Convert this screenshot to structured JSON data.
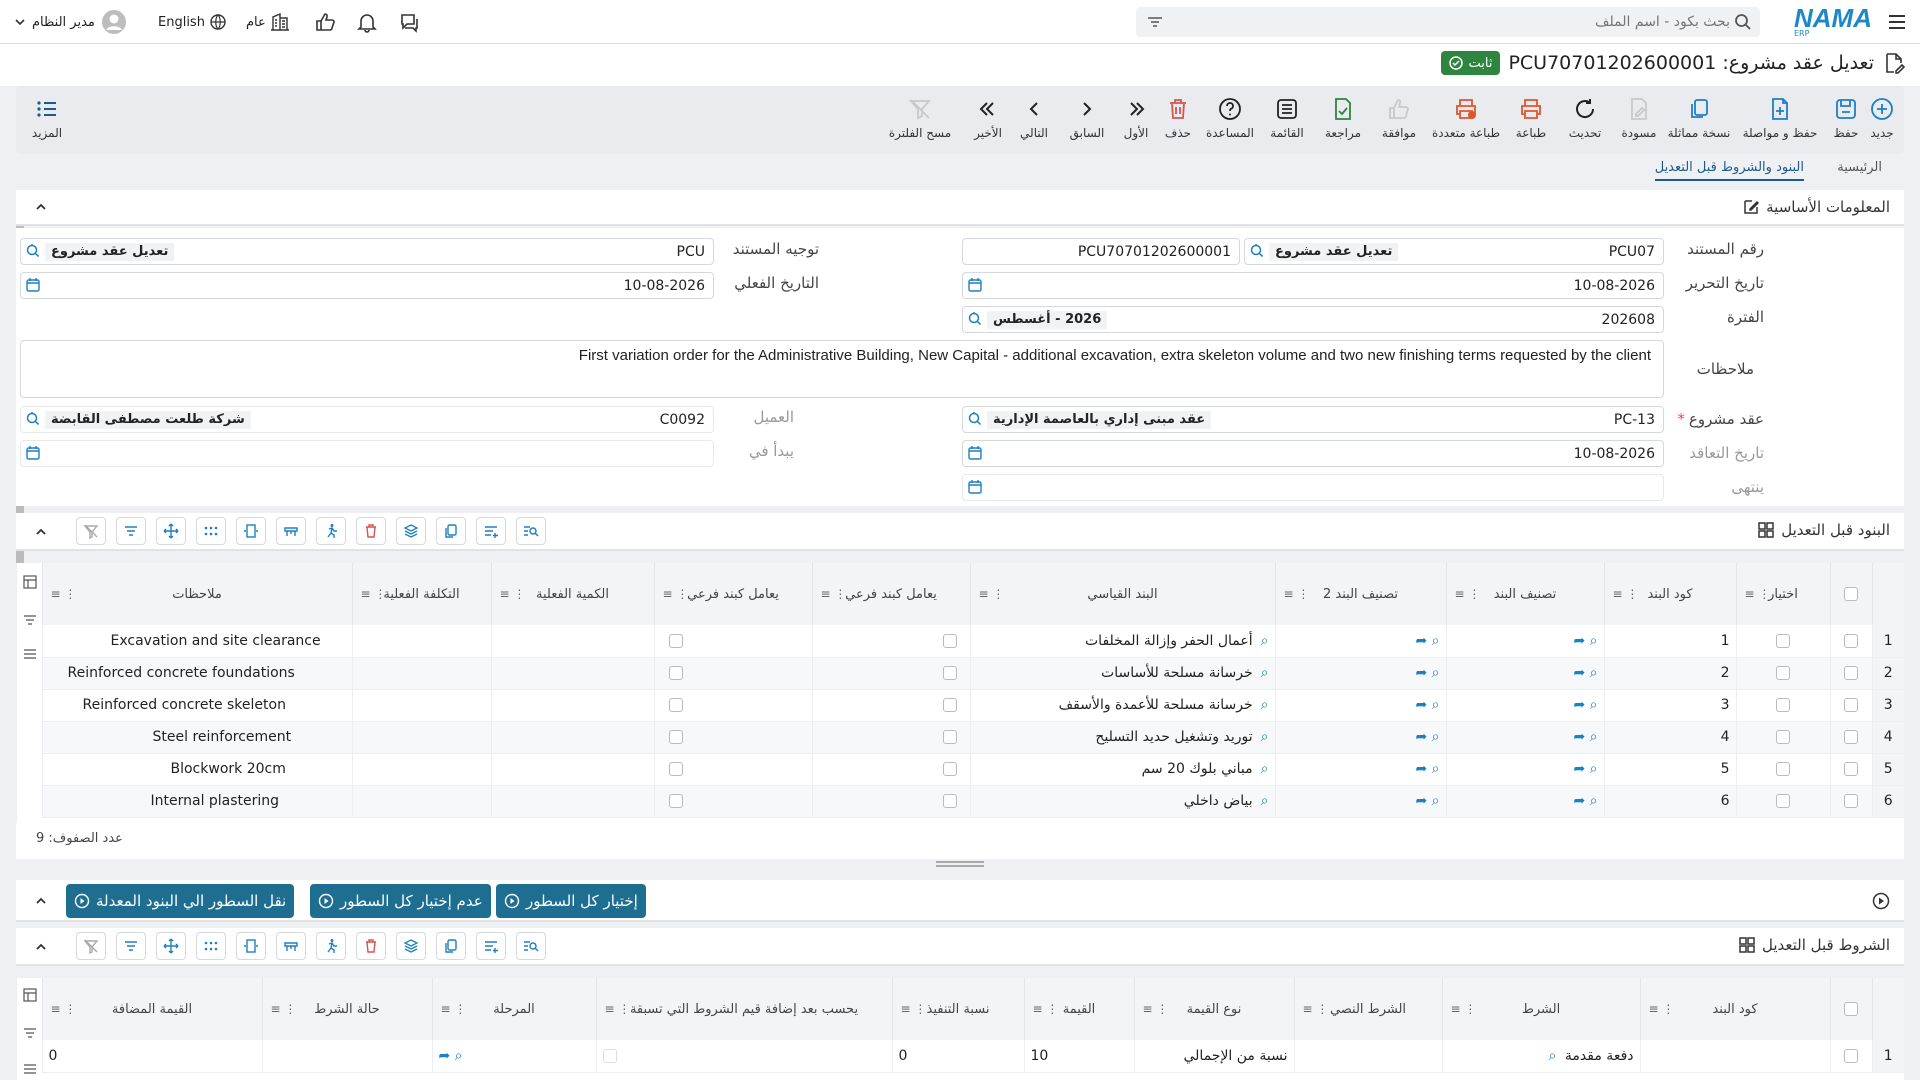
{
  "topbar": {
    "logo": "NAMA",
    "logo_sub": "ERP",
    "search_placeholder": "بحث بكود - اسم الملف",
    "user_name": "مدير النظام",
    "language": "English",
    "scope": "عام"
  },
  "title": {
    "text": "تعديل عقد مشروع: PCU70701202600001",
    "status": "ثابت"
  },
  "toolbar": {
    "items": [
      {
        "label": "جديد",
        "icon": "plus-circle-icon"
      },
      {
        "label": "حفظ",
        "icon": "save-icon"
      },
      {
        "label": "حفظ و مواصلة",
        "icon": "file-plus-icon"
      },
      {
        "label": "نسخة مماثلة",
        "icon": "copy-icon"
      },
      {
        "label": "مسودة",
        "icon": "draft-icon"
      },
      {
        "label": "تحديث",
        "icon": "refresh-icon"
      },
      {
        "label": "طباعة",
        "icon": "print-icon"
      },
      {
        "label": "طباعة متعددة",
        "icon": "multi-print-icon"
      },
      {
        "label": "موافقة",
        "icon": "thumbs-up-icon"
      },
      {
        "label": "مراجعة",
        "icon": "review-icon"
      },
      {
        "label": "القائمة",
        "icon": "list-icon"
      },
      {
        "label": "المساعدة",
        "icon": "help-icon"
      },
      {
        "label": "حذف",
        "icon": "delete-icon"
      },
      {
        "label": "الأول",
        "icon": "first-icon"
      },
      {
        "label": "السابق",
        "icon": "prev-icon"
      },
      {
        "label": "التالي",
        "icon": "next-icon"
      },
      {
        "label": "الأخير",
        "icon": "last-icon"
      },
      {
        "label": "مسح الفلترة",
        "icon": "clear-filter-icon"
      }
    ],
    "more": "المزيد"
  },
  "tabs": [
    "الرئيسية",
    "البنود والشروط قبل التعديل"
  ],
  "basic": {
    "title": "المعلومات الأساسية",
    "doc_number_label": "رقم المستند",
    "doc_number_code": "PCU07",
    "doc_number_name": "تعديل عقد مشروع",
    "doc_number_value": "PCU70701202600001",
    "direction_label": "توجيه المستند",
    "direction_code": "PCU",
    "direction_name": "تعديل عقد مشروع",
    "edit_date_label": "تاريخ التحرير",
    "edit_date": "10-08-2026",
    "actual_date_label": "التاريخ الفعلي",
    "actual_date": "10-08-2026",
    "period_label": "الفترة",
    "period_code": "202608",
    "period_name": "2026 - أغسطس",
    "notes_label": "ملاحظات",
    "notes": "First variation order for the Administrative Building, New Capital - additional excavation, extra skeleton volume and two new finishing terms requested by the client",
    "contract_label": "عقد مشروع",
    "contract_code": "PC-13",
    "contract_name": "عقد مبنى إداري بالعاصمة الإدارية",
    "client_label": "العميل",
    "client_code": "C0092",
    "client_name": "شركة طلعت مصطفى القابضة",
    "contract_date_label": "تاريخ التعاقد",
    "contract_date": "10-08-2026",
    "start_label": "يبدأ في",
    "end_label": "ينتهى"
  },
  "items_section": {
    "title": "البنود قبل التعديل",
    "columns": [
      "اختيار",
      "كود البند",
      "تصنيف البند",
      "تصنيف البند 2",
      "البند القياسي",
      "يعامل كبند فرعي",
      "يعامل كبند فرعي",
      "الكمية الفعلية",
      "التكلفة الفعلية",
      "ملاحظات"
    ],
    "rows": [
      {
        "n": "1",
        "code": "1",
        "std": "أعمال الحفر وإزالة المخلفات",
        "note": "Excavation and site clearance"
      },
      {
        "n": "2",
        "code": "2",
        "std": "خرسانة مسلحة للأساسات",
        "note": "Reinforced concrete foundations"
      },
      {
        "n": "3",
        "code": "3",
        "std": "خرسانة مسلحة للأعمدة والأسقف",
        "note": "Reinforced concrete skeleton"
      },
      {
        "n": "4",
        "code": "4",
        "std": "توريد وتشغيل حديد التسليح",
        "note": "Steel reinforcement"
      },
      {
        "n": "5",
        "code": "5",
        "std": "مباني بلوك 20 سم",
        "note": "Blockwork 20cm"
      },
      {
        "n": "6",
        "code": "6",
        "std": "بياض داخلي",
        "note": "Internal plastering"
      }
    ],
    "row_count": "عدد الصفوف: 9"
  },
  "actions": {
    "select_all": "إختيار كل السطور",
    "deselect_all": "عدم إختيار كل السطور",
    "move_rows": "نقل السطور الي البنود المعدلة"
  },
  "terms_section": {
    "title": "الشروط قبل التعديل",
    "columns": [
      "كود البند",
      "الشرط",
      "الشرط النصي",
      "نوع القيمة",
      "القيمة",
      "نسبة التنفيذ",
      "يحسب بعد إضافة قيم الشروط التي تسبقة",
      "المرحلة",
      "حالة الشرط",
      "القيمة المضافة"
    ],
    "rows": [
      {
        "n": "1",
        "cond": "دفعة مقدمة",
        "type": "نسبة من الإجمالي",
        "value": "10",
        "exec": "0",
        "added": "0"
      }
    ]
  },
  "colors": {
    "primary": "#1d6e91",
    "status_green": "#2e8540",
    "accent_red": "#d9534f"
  }
}
